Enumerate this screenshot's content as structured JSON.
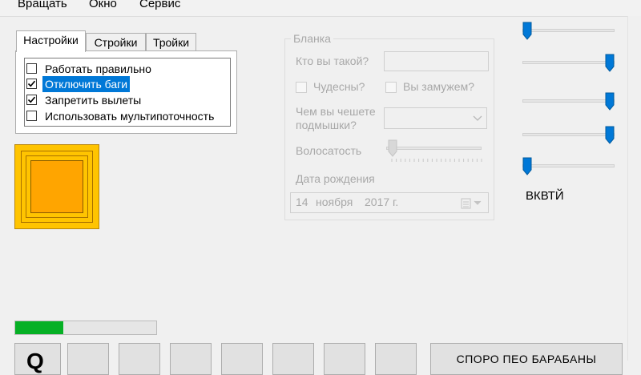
{
  "menu": {
    "items": [
      {
        "label": "Вращать"
      },
      {
        "label": "Окно"
      },
      {
        "label": "Сервис"
      }
    ]
  },
  "tabs": [
    {
      "label": "Настройки"
    },
    {
      "label": "Стройки"
    },
    {
      "label": "Тройки"
    }
  ],
  "checklist": {
    "items": [
      {
        "label": "Работать правильно",
        "checked": false
      },
      {
        "label": "Отключить баги",
        "checked": true
      },
      {
        "label": "Запретить вылеты",
        "checked": true
      },
      {
        "label": "Использовать мультипоточность",
        "checked": false
      }
    ]
  },
  "blanka": {
    "title": "Бланка",
    "who_label": "Кто вы такой?",
    "who_value": "",
    "wonderful_label": "Чудесны?",
    "married_label": "Вы замужем?",
    "scratch_label_1": "Чем вы чешете",
    "scratch_label_2": "подмышки?",
    "scratch_value": "",
    "hair_label": "Волосатость",
    "hair_level": 0,
    "birth_label": "Дата рождения",
    "date": {
      "day": "14",
      "month": "ноября",
      "year": "2017 г."
    }
  },
  "sliders": {
    "levels": [
      0.0,
      1.0,
      1.0,
      1.0,
      0.0
    ],
    "caption": "ВКВТЙ"
  },
  "progress": {
    "value": 0.34
  },
  "bottom": {
    "first_button_glyph": "Q",
    "big_button_label": "СПОРО ПЕО БАРАБАНЫ"
  },
  "colors": {
    "accent": "#0078d7",
    "progress": "#06b025",
    "frame": "#ffc400",
    "frame_inner": "#ffa500"
  }
}
